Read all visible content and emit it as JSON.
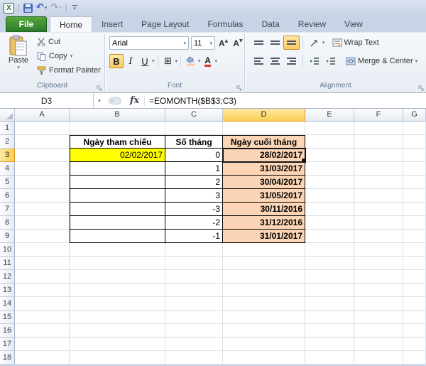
{
  "titlebar": {
    "excel_logo": "X",
    "glyphs": {
      "undo": "↶",
      "redo": "↷",
      "dropdown": "▾"
    }
  },
  "tabs": {
    "file": "File",
    "items": [
      "Home",
      "Insert",
      "Page Layout",
      "Formulas",
      "Data",
      "Review",
      "View"
    ],
    "active": "Home"
  },
  "ribbon": {
    "clipboard": {
      "label": "Clipboard",
      "paste": "Paste",
      "cut": "Cut",
      "copy": "Copy",
      "format_painter": "Format Painter"
    },
    "font": {
      "label": "Font",
      "font_name": "Arial",
      "font_size": "11",
      "bold": "B",
      "italic": "I",
      "underline": "U",
      "grow": "A",
      "shrink": "A",
      "borders_glyph": "⊞",
      "color_letter": "A"
    },
    "alignment": {
      "label": "Alignment",
      "wrap_text": "Wrap Text",
      "merge_center": "Merge & Center"
    }
  },
  "formula_bar": {
    "name_box": "D3",
    "fx_label": "fx",
    "formula": "=EOMONTH($B$3;C3)"
  },
  "sheet": {
    "columns": [
      "A",
      "B",
      "C",
      "D",
      "E",
      "F",
      "G"
    ],
    "rows": [
      "1",
      "2",
      "3",
      "4",
      "5",
      "6",
      "7",
      "8",
      "9",
      "10",
      "11",
      "12",
      "13",
      "14",
      "15",
      "16",
      "17",
      "18"
    ],
    "selected_cell": "D3",
    "selected_column": "D",
    "selected_row": "3",
    "table": {
      "headers": {
        "ref_date": "Ngày tham chiếu",
        "months": "Số tháng",
        "eom": "Ngày cuối tháng"
      },
      "data": [
        {
          "b": "02/02/2017",
          "c": "0",
          "d": "28/02/2017"
        },
        {
          "b": "",
          "c": "1",
          "d": "31/03/2017"
        },
        {
          "b": "",
          "c": "2",
          "d": "30/04/2017"
        },
        {
          "b": "",
          "c": "3",
          "d": "31/05/2017"
        },
        {
          "b": "",
          "c": "-3",
          "d": "30/11/2016"
        },
        {
          "b": "",
          "c": "-2",
          "d": "31/12/2016"
        },
        {
          "b": "",
          "c": "-1",
          "d": "31/01/2017"
        }
      ]
    },
    "colors": {
      "reference_fill": "#FFFF00",
      "result_fill": "#FBD5B5",
      "selection_gold": "#F9CF53"
    }
  }
}
